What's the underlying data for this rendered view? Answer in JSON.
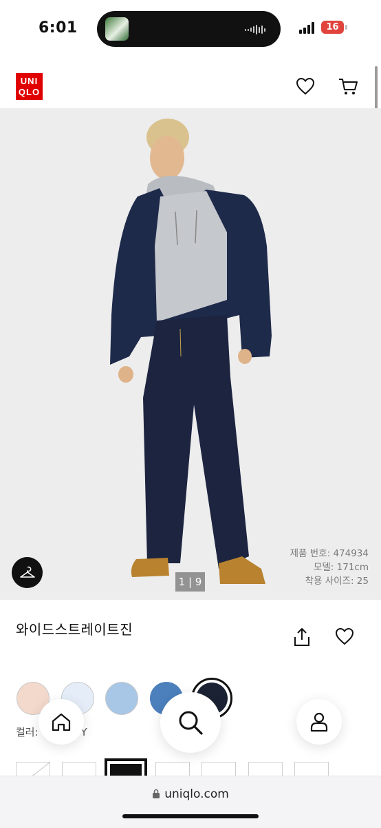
{
  "status_bar": {
    "time": "6:01",
    "battery": "16"
  },
  "header": {
    "logo_line1": "UNI",
    "logo_line2": "QLO",
    "brand_color": "#e00000"
  },
  "hero": {
    "counter": "1 | 9",
    "caption": {
      "product_number": "제품 번호: 474934",
      "model": "모델: 171cm",
      "size": "착용 사이즈: 25"
    }
  },
  "product": {
    "name": "와이드스트레이트진",
    "color_label": "컬러: ",
    "color_value": "/Y",
    "swatches": [
      {
        "color": "#f3d9cb"
      },
      {
        "color": "#e5eef8"
      },
      {
        "color": "#a8c6e6"
      },
      {
        "color": "#4c80bd"
      },
      {
        "color": "#1a2233",
        "selected": true
      }
    ]
  },
  "nav": {
    "home": "home-icon",
    "search": "search-icon",
    "account": "user-icon"
  },
  "browser": {
    "url": "uniqlo.com"
  }
}
